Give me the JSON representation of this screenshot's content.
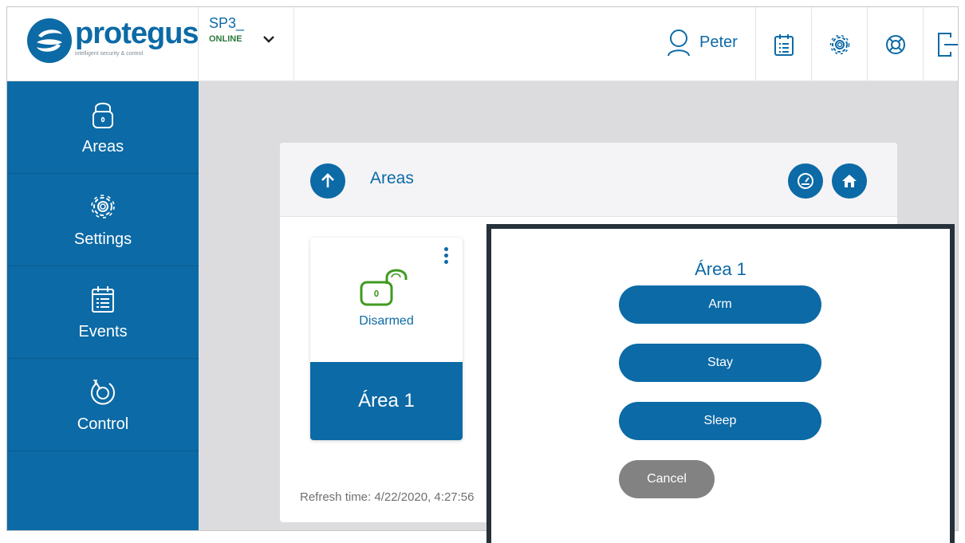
{
  "brand": {
    "name": "protegus",
    "tagline": "intelligent security & control",
    "color": "#0c6aa6"
  },
  "site": {
    "name": "SP3_",
    "status": "ONLINE",
    "status_color": "#2b7a3a"
  },
  "user": {
    "name": "Peter"
  },
  "toolbar": {
    "icons": [
      "calendar-icon",
      "gear-icon",
      "lifebuoy-icon",
      "logout-icon"
    ]
  },
  "sidebar": {
    "items": [
      {
        "label": "Areas",
        "icon": "lock-icon"
      },
      {
        "label": "Settings",
        "icon": "gear-icon"
      },
      {
        "label": "Events",
        "icon": "calendar-icon"
      },
      {
        "label": "Control",
        "icon": "control-icon"
      }
    ]
  },
  "panel": {
    "title": "Areas"
  },
  "area_card": {
    "status": "Disarmed",
    "name": "Área 1",
    "status_color": "#3f9a1f"
  },
  "refresh_text": "Refresh time: 4/22/2020, 4:27:56",
  "modal": {
    "title": "Área 1",
    "buttons": [
      "Arm",
      "Stay",
      "Sleep"
    ],
    "cancel": "Cancel"
  }
}
